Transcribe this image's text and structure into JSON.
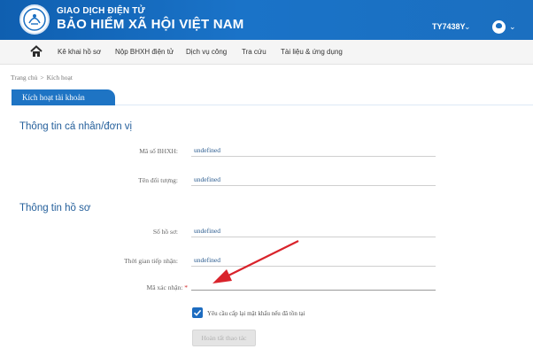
{
  "header": {
    "brand_top": "GIAO DỊCH ĐIỆN TỬ",
    "brand_main": "BẢO HIỂM XÃ HỘI VIỆT NAM",
    "user_code": "TY7438Y"
  },
  "nav": {
    "items": [
      "Kê khai hồ sơ",
      "Nộp BHXH điện tử",
      "Dịch vụ công",
      "Tra cứu",
      "Tài liệu & ứng dụng"
    ]
  },
  "breadcrumb": {
    "home": "Trang chủ",
    "separator": ">",
    "current": "Kích hoạt"
  },
  "tab_title": "Kích hoạt tài khoản",
  "personal_section": {
    "title": "Thông tin cá nhân/đơn vị",
    "fields": [
      {
        "label": "Mã số BHXH:",
        "value": "undefined"
      },
      {
        "label": "Tên đối tượng:",
        "value": "undefined"
      }
    ]
  },
  "dossier_section": {
    "title": "Thông tin hồ sơ",
    "fields": [
      {
        "label": "Số hồ sơ:",
        "value": "undefined"
      },
      {
        "label": "Thời gian tiếp nhận:",
        "value": "undefined"
      }
    ],
    "confirm_code_label": "Mã xác nhận:",
    "required_mark": "*",
    "confirm_code_value": "",
    "checkbox_label": "Yêu cầu cấp lại mật khẩu nếu đã tồn tại",
    "checkbox_checked": true,
    "submit_label": "Hoàn tất thao tác"
  },
  "colors": {
    "header_blue": "#1a6fc2",
    "accent": "#1e74c4",
    "arrow": "#d9232b"
  }
}
